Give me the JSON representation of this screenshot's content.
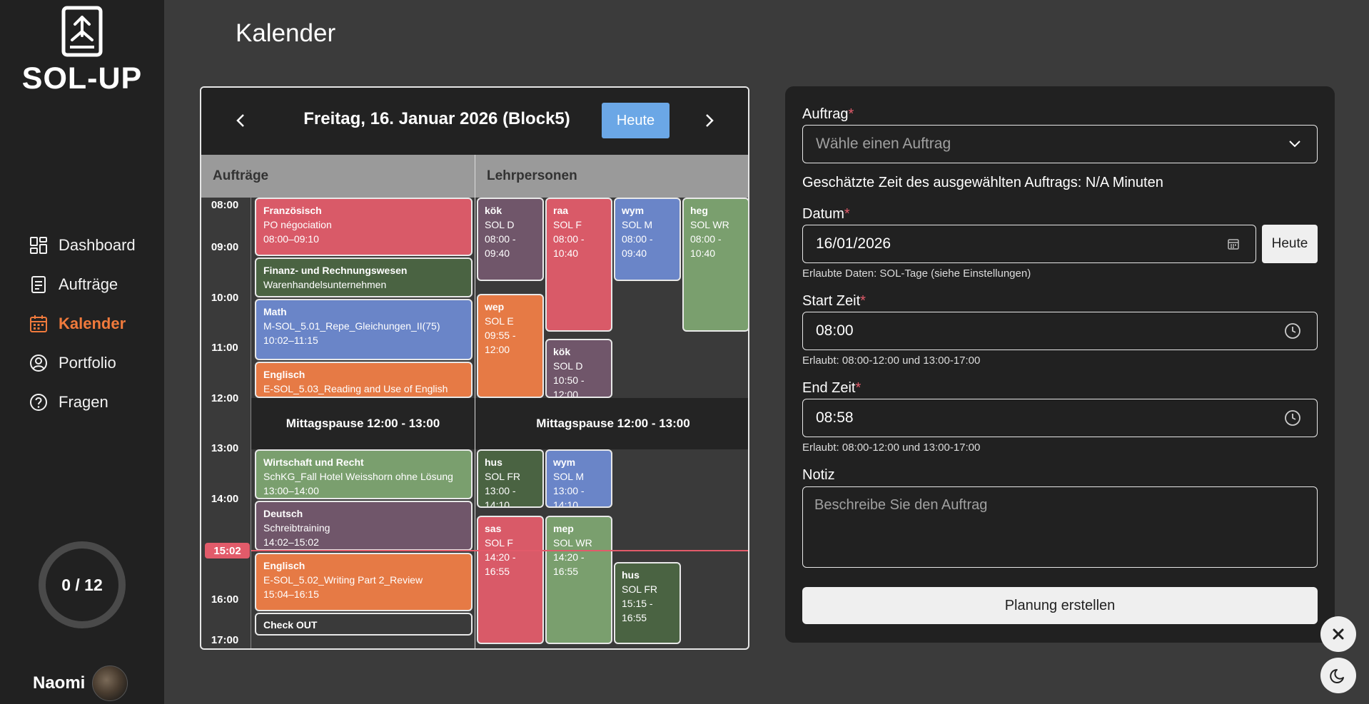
{
  "app": {
    "name": "SOL-UP",
    "page_title": "Kalender"
  },
  "sidebar": {
    "items": [
      {
        "label": "Dashboard",
        "icon": "dashboard-icon"
      },
      {
        "label": "Aufträge",
        "icon": "document-icon"
      },
      {
        "label": "Kalender",
        "icon": "calendar-icon",
        "active": true
      },
      {
        "label": "Portfolio",
        "icon": "user-circle-icon"
      },
      {
        "label": "Fragen",
        "icon": "question-icon"
      }
    ],
    "progress": {
      "text": "0 / 12",
      "done": 0,
      "total": 12
    },
    "user": {
      "name": "Naomi"
    }
  },
  "calendar": {
    "date_title": "Freitag, 16. Januar 2026 (Block5)",
    "today_label": "Heute",
    "col_auftraege": "Aufträge",
    "col_lehrpersonen": "Lehrpersonen",
    "times": [
      "08:00",
      "09:00",
      "10:00",
      "11:00",
      "12:00",
      "13:00",
      "14:00",
      "16:00",
      "17:00"
    ],
    "now_time": "15:02",
    "lunch_label": "Mittagspause 12:00 - 13:00",
    "auftraege": [
      {
        "title": "Französisch",
        "line1": "PO négociation",
        "line2": "08:00–09:10",
        "color": "#d95a68"
      },
      {
        "title": "Finanz- und Rechnungswesen",
        "line1": "Warenhandelsunternehmen",
        "line2": "",
        "color": "#4a6342"
      },
      {
        "title": "Math",
        "line1": "M-SOL_5.01_Repe_Gleichungen_II(75)",
        "line2": "10:02–11:15",
        "color": "#6a85c8"
      },
      {
        "title": "Englisch",
        "line1": "E-SOL_5.03_Reading and Use of English",
        "line2": "",
        "color": "#e67a45"
      },
      {
        "title": "Wirtschaft und Recht",
        "line1": "SchKG_Fall Hotel Weisshorn ohne Lösung",
        "line2": "13:00–14:00",
        "color": "#7a9f6e"
      },
      {
        "title": "Deutsch",
        "line1": "Schreibtraining",
        "line2": "14:02–15:02",
        "color": "#70566a"
      },
      {
        "title": "Englisch",
        "line1": "E-SOL_5.02_Writing Part 2_Review",
        "line2": "15:04–16:15",
        "color": "#e67a45"
      },
      {
        "title": "Check OUT",
        "line1": "",
        "line2": "",
        "color": "#3a3a3a"
      }
    ],
    "lehrpersonen": [
      {
        "title": "kök",
        "line1": "SOL D",
        "line2": "08:00 - 09:40",
        "color": "#70566a"
      },
      {
        "title": "raa",
        "line1": "SOL F",
        "line2": "08:00 - 10:40",
        "color": "#d95a68"
      },
      {
        "title": "wym",
        "line1": "SOL M",
        "line2": "08:00 - 09:40",
        "color": "#6a85c8"
      },
      {
        "title": "heg",
        "line1": "SOL WR",
        "line2": "08:00 - 10:40",
        "color": "#7a9f6e"
      },
      {
        "title": "wep",
        "line1": "SOL E",
        "line2": "09:55 - 12:00",
        "color": "#e67a45"
      },
      {
        "title": "kök",
        "line1": "SOL D",
        "line2": "10:50 - 12:00",
        "color": "#70566a"
      },
      {
        "title": "hus",
        "line1": "SOL FR",
        "line2": "13:00 - 14:10",
        "color": "#4a6342"
      },
      {
        "title": "wym",
        "line1": "SOL M",
        "line2": "13:00 - 14:10",
        "color": "#6a85c8"
      },
      {
        "title": "sas",
        "line1": "SOL F",
        "line2": "14:20 - 16:55",
        "color": "#d95a68"
      },
      {
        "title": "mep",
        "line1": "SOL WR",
        "line2": "14:20 - 16:55",
        "color": "#7a9f6e"
      },
      {
        "title": "hus",
        "line1": "SOL FR",
        "line2": "15:15 - 16:55",
        "color": "#4a6342"
      }
    ]
  },
  "form": {
    "auftrag_label": "Auftrag",
    "auftrag_placeholder": "Wähle einen Auftrag",
    "estimate_text": "Geschätzte Zeit des ausgewählten Auftrags: N/A Minuten",
    "datum_label": "Datum",
    "datum_value": "16/01/2026",
    "datum_today": "Heute",
    "datum_hint": "Erlaubte Daten: SOL-Tage (siehe Einstellungen)",
    "start_label": "Start Zeit",
    "start_value": "08:00",
    "start_hint": "Erlaubt: 08:00-12:00 und 13:00-17:00",
    "end_label": "End Zeit",
    "end_value": "08:58",
    "end_hint": "Erlaubt: 08:00-12:00 und 13:00-17:00",
    "notiz_label": "Notiz",
    "notiz_placeholder": "Beschreibe Sie den Auftrag",
    "submit_label": "Planung erstellen",
    "required_mark": "*"
  }
}
